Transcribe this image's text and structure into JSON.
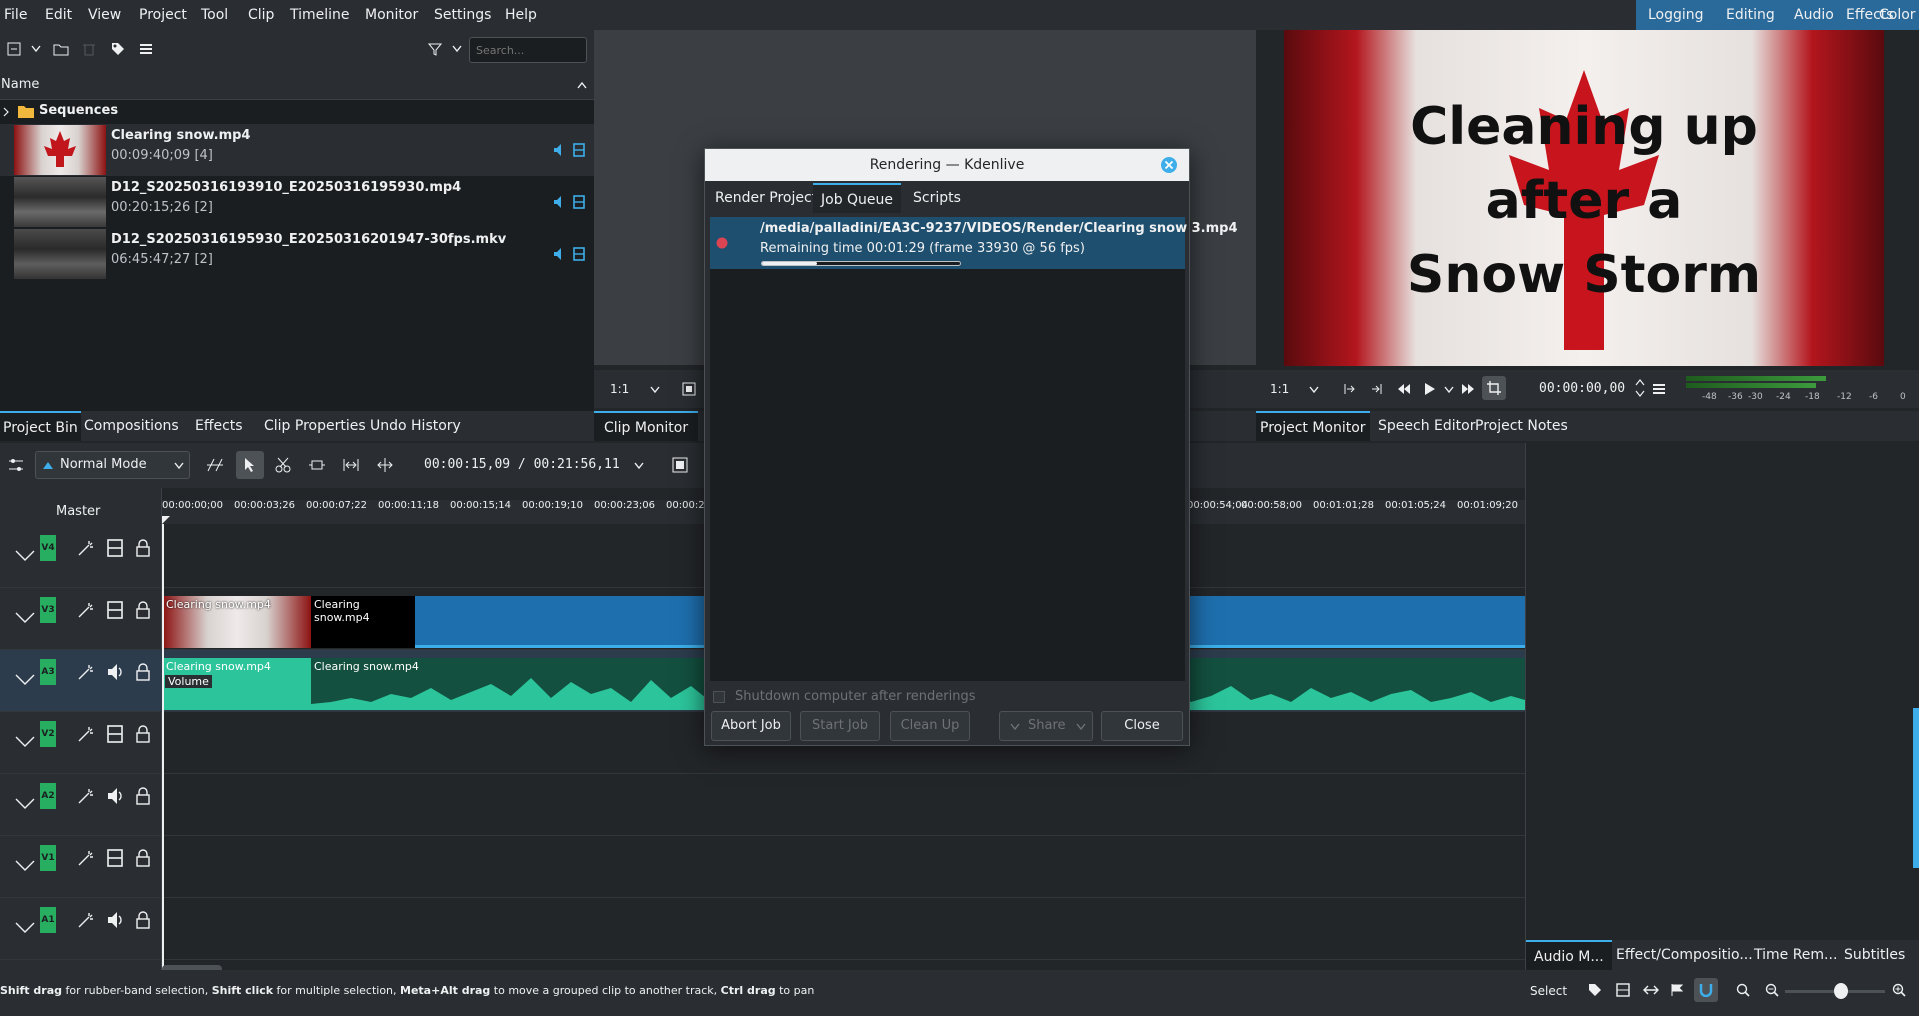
{
  "menubar": {
    "items": [
      "File",
      "Edit",
      "View",
      "Project",
      "Tool",
      "Clip",
      "Timeline",
      "Monitor",
      "Settings",
      "Help"
    ],
    "workspaces": [
      "Logging",
      "Editing",
      "Audio",
      "Effects",
      "Color"
    ]
  },
  "bin": {
    "search_placeholder": "Search...",
    "column_name": "Name",
    "folder": "Sequences",
    "clips": [
      {
        "name": "Clearing snow.mp4",
        "meta": "00:09:40;09 [4]"
      },
      {
        "name": "D12_S20250316193910_E20250316195930.mp4",
        "meta": "00:20:15;26 [2]"
      },
      {
        "name": "D12_S20250316195930_E20250316201947-30fps.mkv",
        "meta": "06:45:47;27 [2]"
      }
    ],
    "thumb_text": "Cleaning up after a Snow Storm",
    "tabs": [
      "Project Bin",
      "Compositions",
      "Effects",
      "Clip Properties",
      "Undo History"
    ]
  },
  "clip_monitor": {
    "zoom": "1:1",
    "tab": "Clip Monitor"
  },
  "project_monitor": {
    "zoom": "1:1",
    "timecode": "00:00:00,00",
    "title_lines": [
      "Cleaning up",
      "after a",
      "Snow Storm"
    ],
    "meter_labels": [
      "-48",
      "-36",
      "-30",
      "-24",
      "-18",
      "-12",
      "-6",
      "0"
    ],
    "tabs": [
      "Project Monitor",
      "Speech Editor",
      "Project Notes"
    ]
  },
  "timeline": {
    "mode": "Normal Mode",
    "position": "00:00:15,09 / 00:21:56,11",
    "master_label": "Master",
    "ruler": [
      "00:00:00;00",
      "00:00:03;26",
      "00:00:07;22",
      "00:00:11;18",
      "00:00:15;14",
      "00:00:19;10",
      "00:00:23;06",
      "00:00:2",
      "00:00:54;04",
      "00:00:58;00",
      "00:01:01;28",
      "00:01:05;24",
      "00:01:09;20"
    ],
    "tracks": [
      "V4",
      "V3",
      "A3",
      "V2",
      "A2",
      "V1",
      "A1"
    ],
    "clips": {
      "v3_a": "Clearing snow.mp4",
      "v3_b": "Clearing snow.mp4",
      "a3_a": "Clearing snow.mp4",
      "a3_b": "Clearing snow.mp4",
      "effect_badge": "Volume"
    }
  },
  "dialog": {
    "title": "Rendering — Kdenlive",
    "tabs": [
      "Render Project",
      "Job Queue",
      "Scripts"
    ],
    "job_path": "/media/palladini/EA3C-9237/VIDEOS/Render/Clearing snow 3.mp4",
    "job_status": "Remaining time 00:01:29 (frame 33930 @ 56 fps)",
    "job_progress": 0.28,
    "shutdown_label": "Shutdown computer after renderings",
    "buttons": {
      "abort": "Abort Job",
      "start": "Start Job",
      "cleanup": "Clean Up",
      "share": "Share",
      "close": "Close"
    }
  },
  "right_tabs": [
    "Audio M...",
    "Effect/Compositio...",
    "Time Rem...",
    "Subtitles"
  ],
  "status": {
    "parts": [
      {
        "b": "Shift drag"
      },
      {
        "t": " for rubber-band selection, "
      },
      {
        "b": "Shift click"
      },
      {
        "t": " for multiple selection, "
      },
      {
        "b": "Meta+Alt drag"
      },
      {
        "t": " to move a grouped clip to another track, "
      },
      {
        "b": "Ctrl drag"
      },
      {
        "t": " to pan"
      }
    ],
    "select_label": "Select"
  },
  "colors": {
    "accent": "#3daee9",
    "clip_video": "#1e6fae",
    "clip_audio": "#2cc59b",
    "track_label": "#27ae60",
    "job_dot": "#da4453"
  }
}
